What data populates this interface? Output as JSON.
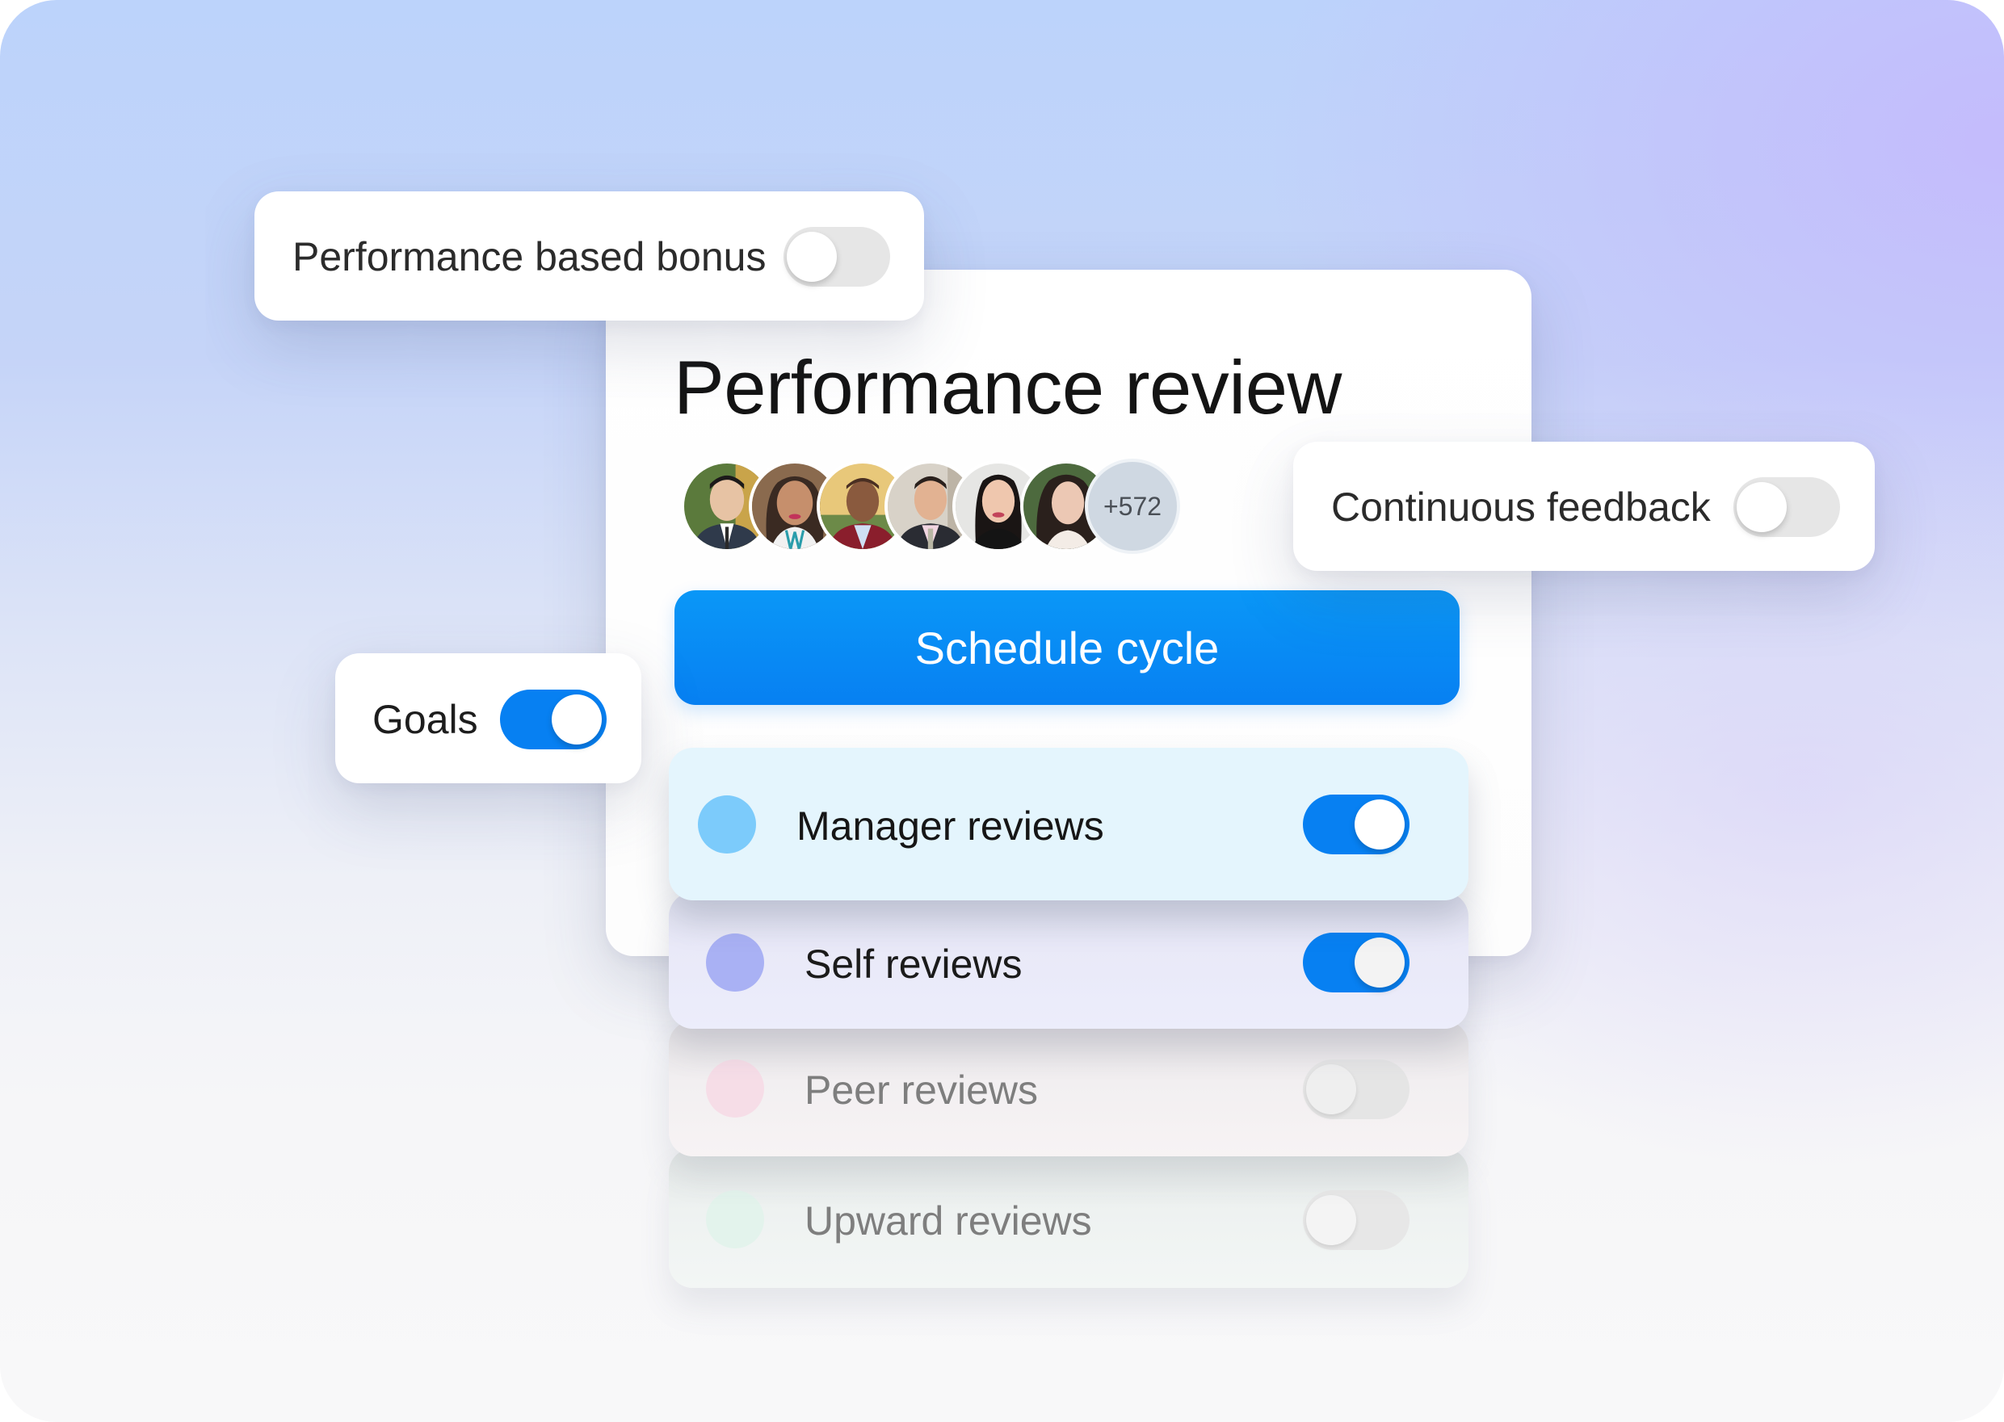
{
  "colors": {
    "accent": "#0780f2",
    "toggle_off": "#e6e6e6",
    "manager_dot": "#7ccbfb",
    "self_dot": "#a9b1f4",
    "peer_dot": "#f6dde7",
    "upward_dot": "#e3f3ec"
  },
  "floating_options": {
    "bonus": {
      "label": "Performance based bonus",
      "enabled": false
    },
    "continuous_feedback": {
      "label": "Continuous feedback",
      "enabled": false
    },
    "goals": {
      "label": "Goals",
      "enabled": true
    }
  },
  "main_card": {
    "title": "Performance review",
    "participants": {
      "avatars": [
        {
          "icon": "avatar-person-1"
        },
        {
          "icon": "avatar-person-2"
        },
        {
          "icon": "avatar-person-3"
        },
        {
          "icon": "avatar-person-4"
        },
        {
          "icon": "avatar-person-5"
        },
        {
          "icon": "avatar-person-6"
        }
      ],
      "more_count": "+572"
    },
    "schedule_button": "Schedule cycle"
  },
  "review_types": [
    {
      "label": "Manager reviews",
      "enabled": true
    },
    {
      "label": "Self reviews",
      "enabled": true
    },
    {
      "label": "Peer reviews",
      "enabled": false
    },
    {
      "label": "Upward reviews",
      "enabled": false
    }
  ]
}
